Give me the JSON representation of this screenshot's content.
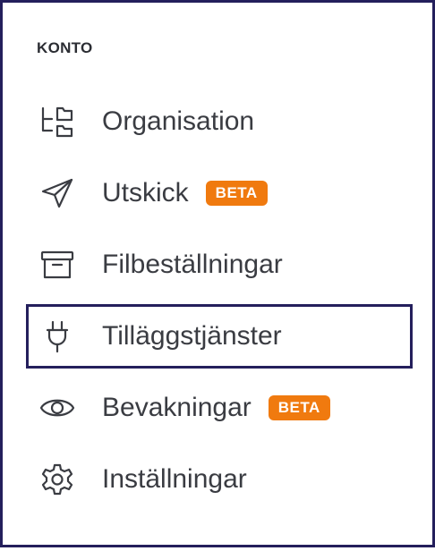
{
  "section": {
    "title": "KONTO"
  },
  "menu": {
    "items": [
      {
        "label": "Organisation",
        "icon": "folder-tree-icon",
        "badge": ""
      },
      {
        "label": "Utskick",
        "icon": "paper-plane-icon",
        "badge": "BETA"
      },
      {
        "label": "Filbeställningar",
        "icon": "archive-box-icon",
        "badge": ""
      },
      {
        "label": "Tilläggstjänster",
        "icon": "plug-icon",
        "badge": "",
        "active": true
      },
      {
        "label": "Bevakningar",
        "icon": "eye-icon",
        "badge": "BETA"
      },
      {
        "label": "Inställningar",
        "icon": "gear-icon",
        "badge": ""
      }
    ]
  },
  "colors": {
    "frame": "#241f5c",
    "text": "#3a3c42",
    "badge": "#f07a0f"
  }
}
